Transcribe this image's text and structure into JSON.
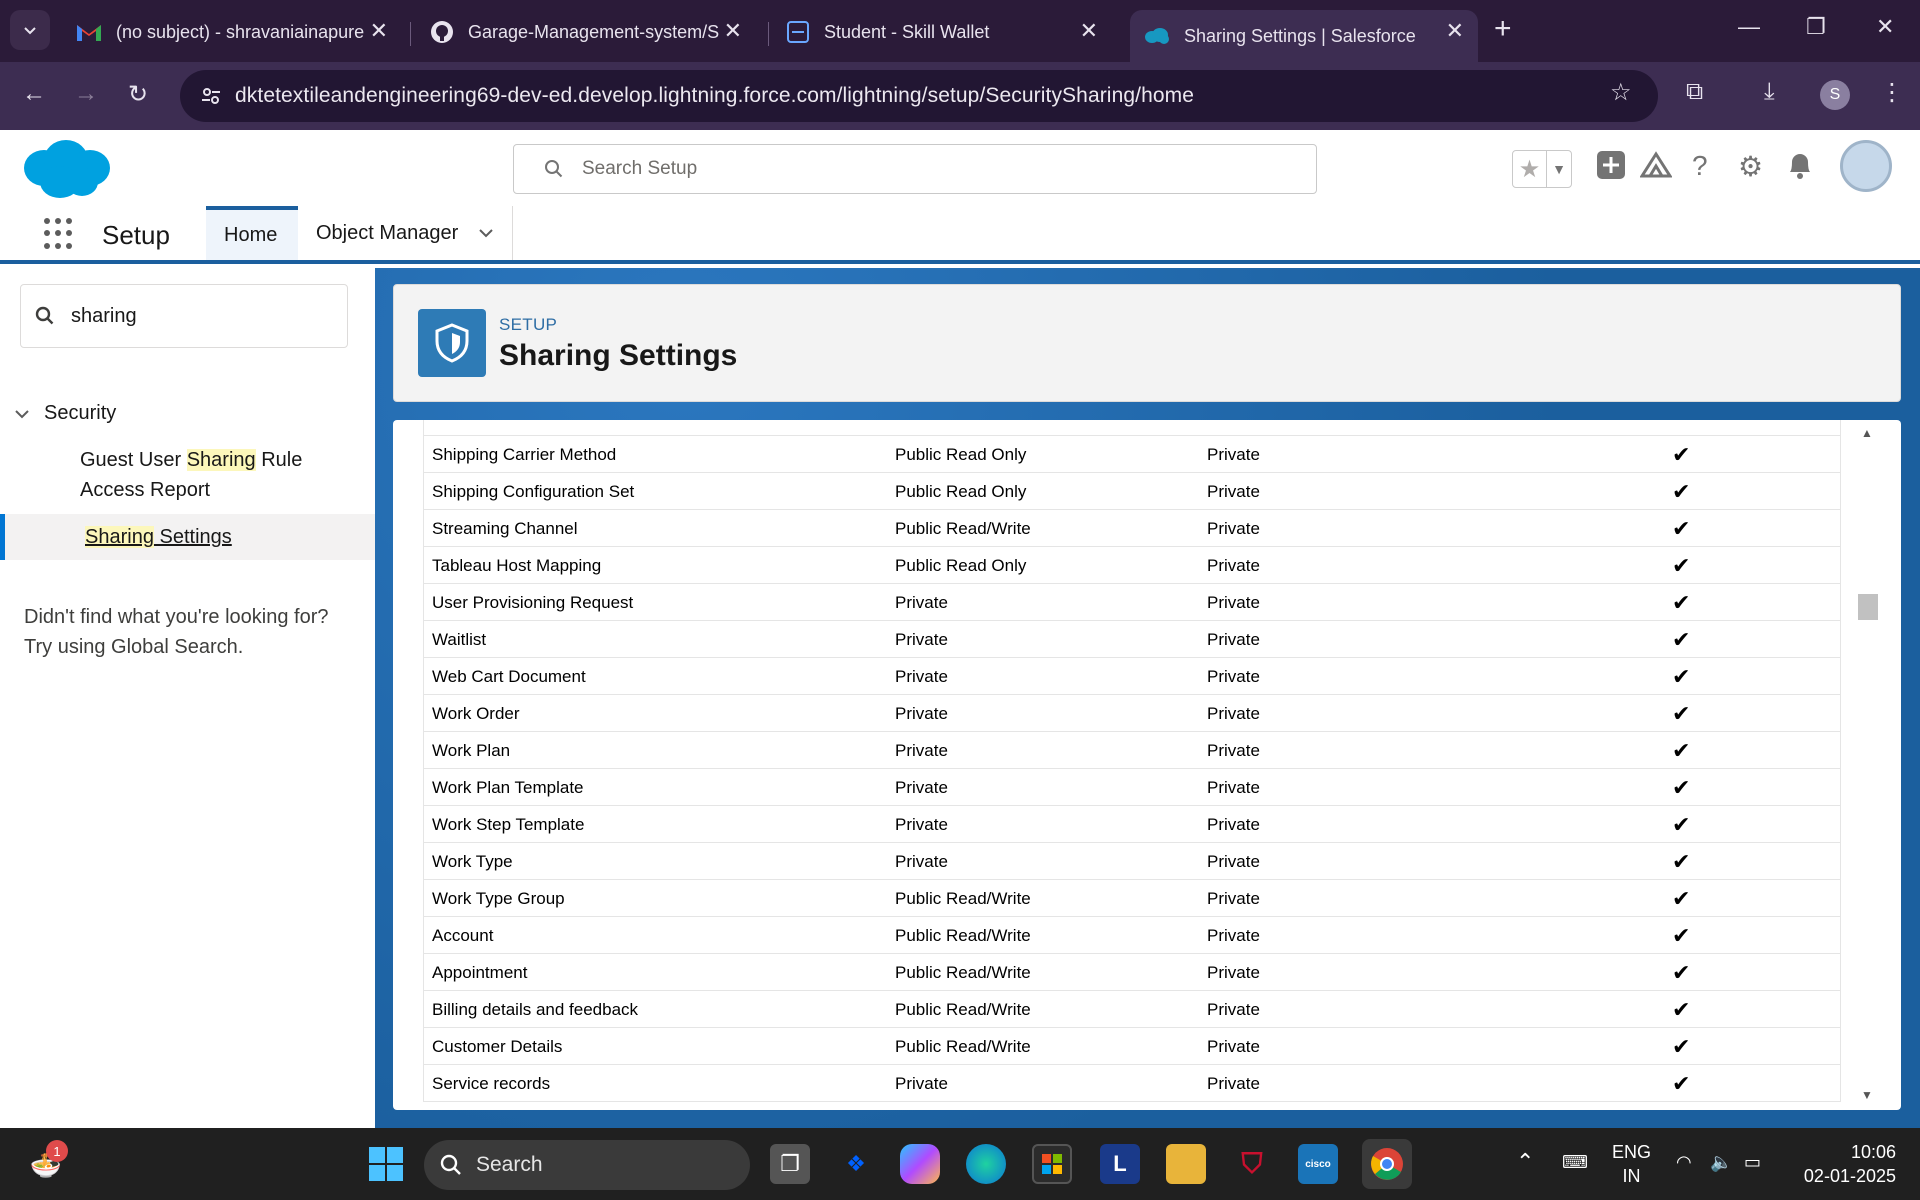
{
  "browser": {
    "tabs": [
      {
        "title": "(no subject) - shravaniainapure",
        "icon": "gmail-icon"
      },
      {
        "title": "Garage-Management-system/S",
        "icon": "github-icon"
      },
      {
        "title": "Student - Skill Wallet",
        "icon": "skill-wallet-icon"
      },
      {
        "title": "Sharing Settings | Salesforce",
        "icon": "salesforce-icon",
        "active": true
      }
    ],
    "url": "dktetextileandengineering69-dev-ed.develop.lightning.force.com/lightning/setup/SecuritySharing/home",
    "profile_initial": "S"
  },
  "header": {
    "search_placeholder": "Search Setup"
  },
  "nav": {
    "app_name": "Setup",
    "tabs": [
      "Home",
      "Object Manager"
    ]
  },
  "sidebar": {
    "quick_find_value": "sharing",
    "section": "Security",
    "items": [
      {
        "pre": "Guest User ",
        "hl": "Sharing",
        "post": " Rule Access Report"
      },
      {
        "pre": "",
        "hl": "Sharing",
        "post": " Settings",
        "selected": true
      }
    ],
    "not_found": "Didn't find what you're looking for? Try using Global Search."
  },
  "page": {
    "eyebrow": "SETUP",
    "title": "Sharing Settings"
  },
  "table": {
    "rows": [
      [
        "Shipping Carrier Method",
        "Public Read Only",
        "Private",
        "✔"
      ],
      [
        "Shipping Configuration Set",
        "Public Read Only",
        "Private",
        "✔"
      ],
      [
        "Streaming Channel",
        "Public Read/Write",
        "Private",
        "✔"
      ],
      [
        "Tableau Host Mapping",
        "Public Read Only",
        "Private",
        "✔"
      ],
      [
        "User Provisioning Request",
        "Private",
        "Private",
        "✔"
      ],
      [
        "Waitlist",
        "Private",
        "Private",
        "✔"
      ],
      [
        "Web Cart Document",
        "Private",
        "Private",
        "✔"
      ],
      [
        "Work Order",
        "Private",
        "Private",
        "✔"
      ],
      [
        "Work Plan",
        "Private",
        "Private",
        "✔"
      ],
      [
        "Work Plan Template",
        "Private",
        "Private",
        "✔"
      ],
      [
        "Work Step Template",
        "Private",
        "Private",
        "✔"
      ],
      [
        "Work Type",
        "Private",
        "Private",
        "✔"
      ],
      [
        "Work Type Group",
        "Public Read/Write",
        "Private",
        "✔"
      ],
      [
        "Account",
        "Public Read/Write",
        "Private",
        "✔"
      ],
      [
        "Appointment",
        "Public Read/Write",
        "Private",
        "✔"
      ],
      [
        "Billing details and feedback",
        "Public Read/Write",
        "Private",
        "✔"
      ],
      [
        "Customer Details",
        "Public Read/Write",
        "Private",
        "✔"
      ],
      [
        "Service records",
        "Private",
        "Private",
        "✔"
      ]
    ]
  },
  "taskbar": {
    "search_label": "Search",
    "notification_count": "1",
    "lang": "ENG",
    "region": "IN",
    "time": "10:06",
    "date": "02-01-2025"
  }
}
